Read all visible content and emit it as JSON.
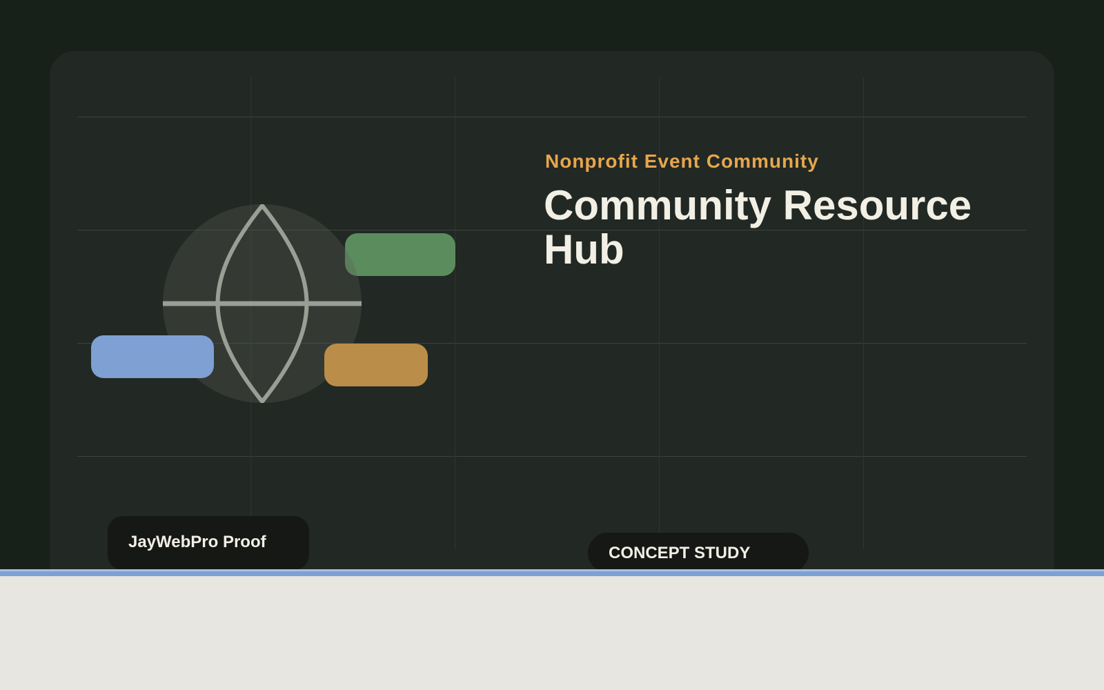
{
  "hero": {
    "eyebrow": "Nonprofit Event Community",
    "title": "Community Resource Hub"
  },
  "badges": {
    "brand": "JayWebPro Proof",
    "concept": "CONCEPT STUDY"
  },
  "icons": {
    "emblem": "globe-leaf-icon"
  },
  "colors": {
    "background": "#18201a",
    "panel": "#222823",
    "accent_orange": "#e6a64e",
    "accent_green": "#5a8c5e",
    "accent_blue": "#7ea0d2",
    "accent_amber": "#ba8d49",
    "page_light": "#e7e6e0",
    "text_light": "#f2efe5"
  }
}
